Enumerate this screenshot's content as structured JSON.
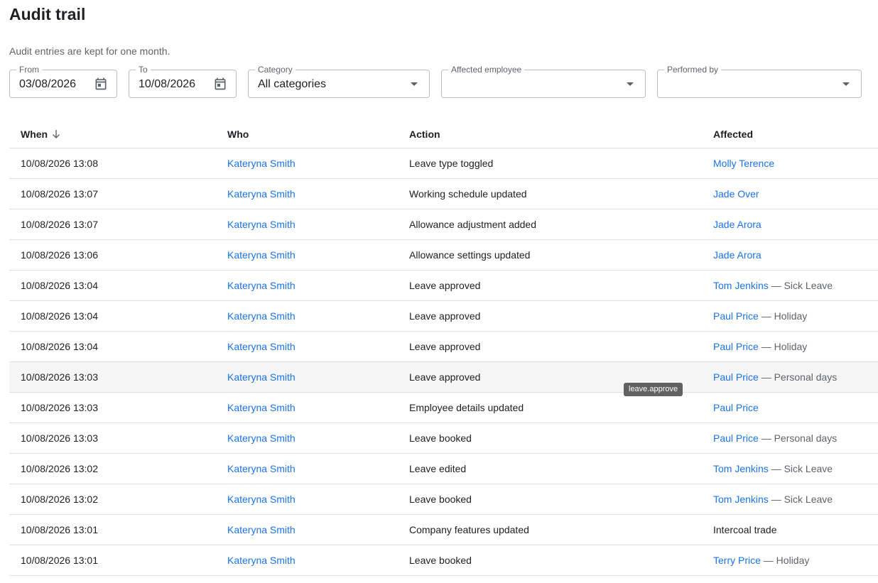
{
  "page": {
    "title": "Audit trail",
    "retention_note": "Audit entries are kept for one month."
  },
  "filters": {
    "from": {
      "label": "From",
      "value": "03/08/2026",
      "icon": "calendar-icon"
    },
    "to": {
      "label": "To",
      "value": "10/08/2026",
      "icon": "calendar-icon"
    },
    "category": {
      "label": "Category",
      "value": "All categories"
    },
    "affected_employee": {
      "label": "Affected employee",
      "value": ""
    },
    "performed_by": {
      "label": "Performed by",
      "value": ""
    }
  },
  "table": {
    "columns": {
      "when": "When",
      "who": "Who",
      "action": "Action",
      "affected": "Affected"
    },
    "sort_icon": "arrow-down-icon",
    "rows": [
      {
        "when": "10/08/2026 13:08",
        "who": "Kateryna Smith",
        "action": "Leave type toggled",
        "affected": "Molly Terence",
        "detail": "",
        "affected_link": true
      },
      {
        "when": "10/08/2026 13:07",
        "who": "Kateryna Smith",
        "action": "Working schedule updated",
        "affected": "Jade Over",
        "detail": "",
        "affected_link": true
      },
      {
        "when": "10/08/2026 13:07",
        "who": "Kateryna Smith",
        "action": "Allowance adjustment added",
        "affected": "Jade Arora",
        "detail": "",
        "affected_link": true
      },
      {
        "when": "10/08/2026 13:06",
        "who": "Kateryna Smith",
        "action": "Allowance settings updated",
        "affected": "Jade Arora",
        "detail": "",
        "affected_link": true
      },
      {
        "when": "10/08/2026 13:04",
        "who": "Kateryna Smith",
        "action": "Leave approved",
        "affected": "Tom Jenkins",
        "detail": " — Sick Leave",
        "affected_link": true
      },
      {
        "when": "10/08/2026 13:04",
        "who": "Kateryna Smith",
        "action": "Leave approved",
        "affected": "Paul Price",
        "detail": " — Holiday",
        "affected_link": true
      },
      {
        "when": "10/08/2026 13:04",
        "who": "Kateryna Smith",
        "action": "Leave approved",
        "affected": "Paul Price",
        "detail": " — Holiday",
        "affected_link": true
      },
      {
        "when": "10/08/2026 13:03",
        "who": "Kateryna Smith",
        "action": "Leave approved",
        "affected": "Paul Price",
        "detail": " — Personal days",
        "affected_link": true
      },
      {
        "when": "10/08/2026 13:03",
        "who": "Kateryna Smith",
        "action": "Employee details updated",
        "affected": "Paul Price",
        "detail": "",
        "affected_link": true
      },
      {
        "when": "10/08/2026 13:03",
        "who": "Kateryna Smith",
        "action": "Leave booked",
        "affected": "Paul Price",
        "detail": " — Personal days",
        "affected_link": true
      },
      {
        "when": "10/08/2026 13:02",
        "who": "Kateryna Smith",
        "action": "Leave edited",
        "affected": "Tom Jenkins",
        "detail": " — Sick Leave",
        "affected_link": true
      },
      {
        "when": "10/08/2026 13:02",
        "who": "Kateryna Smith",
        "action": "Leave booked",
        "affected": "Tom Jenkins",
        "detail": " — Sick Leave",
        "affected_link": true
      },
      {
        "when": "10/08/2026 13:01",
        "who": "Kateryna Smith",
        "action": "Company features updated",
        "affected": "Intercoal trade",
        "detail": "",
        "affected_link": false
      },
      {
        "when": "10/08/2026 13:01",
        "who": "Kateryna Smith",
        "action": "Leave booked",
        "affected": "Terry Price",
        "detail": " — Holiday",
        "affected_link": true
      }
    ]
  },
  "tooltip": {
    "text": "leave.approve"
  }
}
